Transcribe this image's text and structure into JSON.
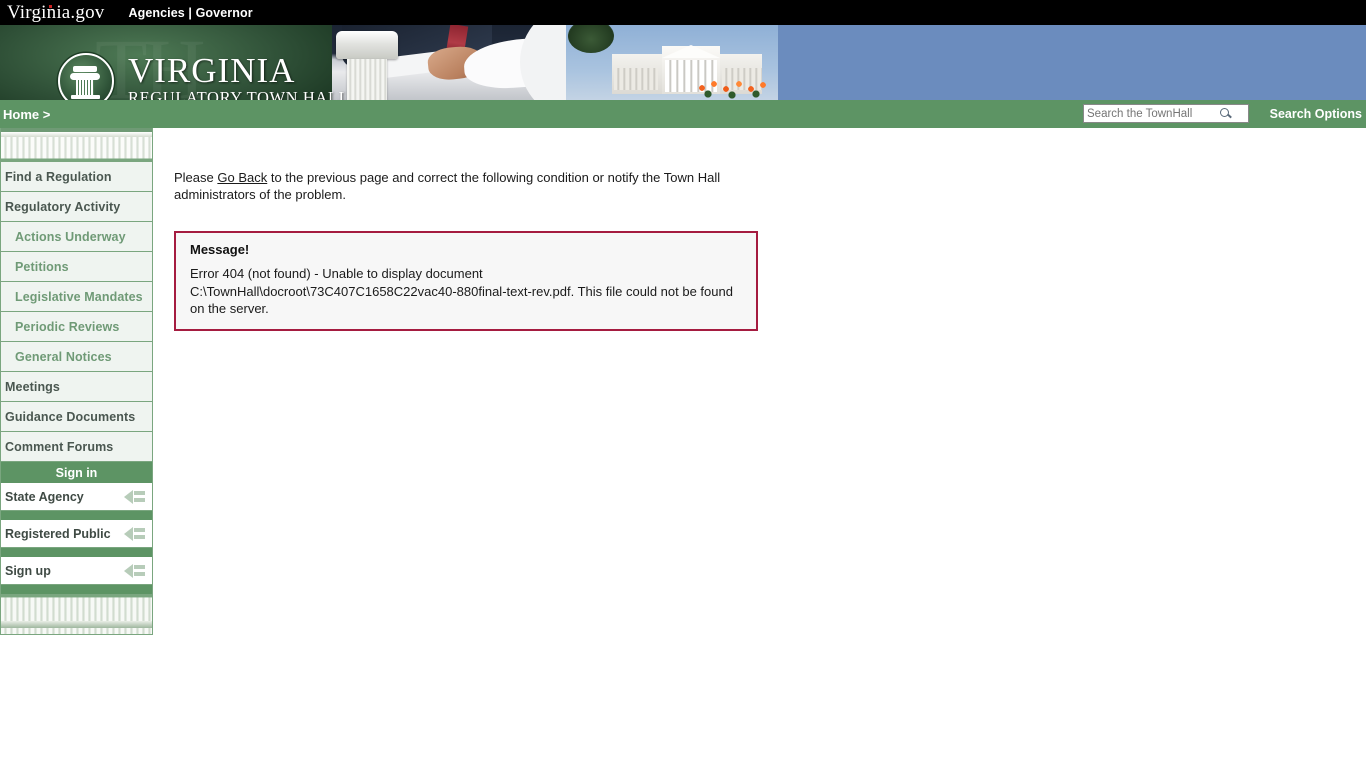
{
  "topbar": {
    "brand": "Virginia.gov",
    "nav": "Agencies | Governor"
  },
  "banner": {
    "title": "VIRGINIA",
    "subtitle": "REGULATORY TOWN HALL",
    "ghost_text": "TH"
  },
  "navstrip": {
    "breadcrumb": "Home >",
    "search_placeholder": "Search the TownHall",
    "search_value": "",
    "search_options_label": "Search Options"
  },
  "sidebar": {
    "items": [
      {
        "label": "Find a Regulation",
        "level": "top"
      },
      {
        "label": "Regulatory Activity",
        "level": "top"
      },
      {
        "label": "Actions Underway",
        "level": "sub"
      },
      {
        "label": "Petitions",
        "level": "sub"
      },
      {
        "label": "Legislative Mandates",
        "level": "sub"
      },
      {
        "label": "Periodic Reviews",
        "level": "sub"
      },
      {
        "label": "General Notices",
        "level": "sub"
      },
      {
        "label": "Meetings",
        "level": "top"
      },
      {
        "label": "Guidance Documents",
        "level": "top"
      },
      {
        "label": "Comment Forums",
        "level": "top"
      }
    ],
    "signin_header": "Sign in",
    "signin_rows": [
      {
        "label": "State Agency"
      },
      {
        "label": "Registered Public"
      },
      {
        "label": "Sign up"
      }
    ]
  },
  "main": {
    "intro_before": "Please ",
    "intro_link": "Go Back",
    "intro_after": " to the previous page and correct the following condition or notify the Town Hall administrators of the problem.",
    "message_title": "Message!",
    "message_body": "Error 404 (not found) - Unable to display document C:\\TownHall\\docroot\\73C407C1658C22vac40-880final-text-rev.pdf. This file could not be found on the server."
  },
  "colors": {
    "green": "#5d9464",
    "green_border": "#7aa67f",
    "error_border": "#a51c40",
    "sky_blue": "#6b8cbe"
  }
}
